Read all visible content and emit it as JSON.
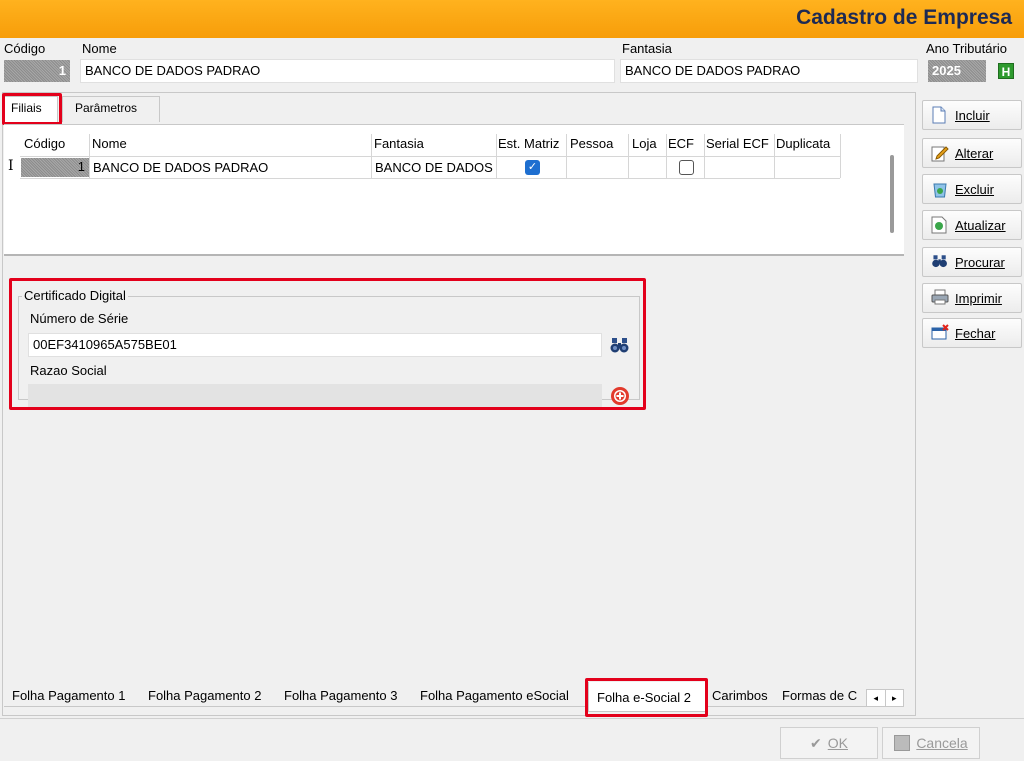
{
  "window": {
    "title": "Cadastro de Empresa"
  },
  "header": {
    "codigo_label": "Código",
    "codigo_value": "1",
    "nome_label": "Nome",
    "nome_value": "BANCO DE DADOS PADRAO",
    "fantasia_label": "Fantasia",
    "fantasia_value": "BANCO DE DADOS PADRAO",
    "ano_label": "Ano Tributário",
    "ano_value": "2025",
    "ano_button": "H"
  },
  "top_tabs": [
    {
      "label": "Filiais",
      "active": true
    },
    {
      "label": "Parâmetros",
      "active": false
    }
  ],
  "grid": {
    "columns": [
      "Código",
      "Nome",
      "Fantasia",
      "Est. Matriz",
      "Pessoa",
      "Loja",
      "ECF",
      "Serial ECF",
      "Duplicata"
    ],
    "rows": [
      {
        "codigo": "1",
        "nome": "BANCO DE DADOS PADRAO",
        "fantasia": "BANCO DE DADOS",
        "est_matriz": true,
        "pessoa": "",
        "loja": "",
        "ecf": false,
        "serial_ecf": "",
        "duplicata": ""
      }
    ],
    "row_marker": "I"
  },
  "certificado": {
    "group_label": "Certificado Digital",
    "serie_label": "Número de Série",
    "serie_value": "00EF3410965A575BE01",
    "razao_label": "Razao Social",
    "razao_value": ""
  },
  "side_buttons": [
    {
      "label": "Incluir",
      "icon": "new-document-icon"
    },
    {
      "label": "Alterar",
      "icon": "edit-icon"
    },
    {
      "label": "Excluir",
      "icon": "recycle-bin-icon"
    },
    {
      "label": "Atualizar",
      "icon": "refresh-icon"
    },
    {
      "label": "Procurar",
      "icon": "binoculars-icon"
    },
    {
      "label": "Imprimir",
      "icon": "printer-icon"
    },
    {
      "label": "Fechar",
      "icon": "close-window-icon"
    }
  ],
  "bottom_tabs": [
    {
      "label": "Folha Pagamento 1",
      "active": false
    },
    {
      "label": "Folha Pagamento 2",
      "active": false
    },
    {
      "label": "Folha Pagamento 3",
      "active": false
    },
    {
      "label": "Folha Pagamento eSocial",
      "active": false
    },
    {
      "label": "Folha e-Social 2",
      "active": true
    },
    {
      "label": "Carimbos",
      "active": false
    },
    {
      "label": "Formas de C",
      "active": false
    }
  ],
  "footer": {
    "ok_label": "OK",
    "cancel_label": "Cancela"
  },
  "colors": {
    "title_bar": "#f7a10f",
    "title_text": "#1d2a54",
    "highlight": "#e3001b",
    "check": "#1e6fd0"
  }
}
